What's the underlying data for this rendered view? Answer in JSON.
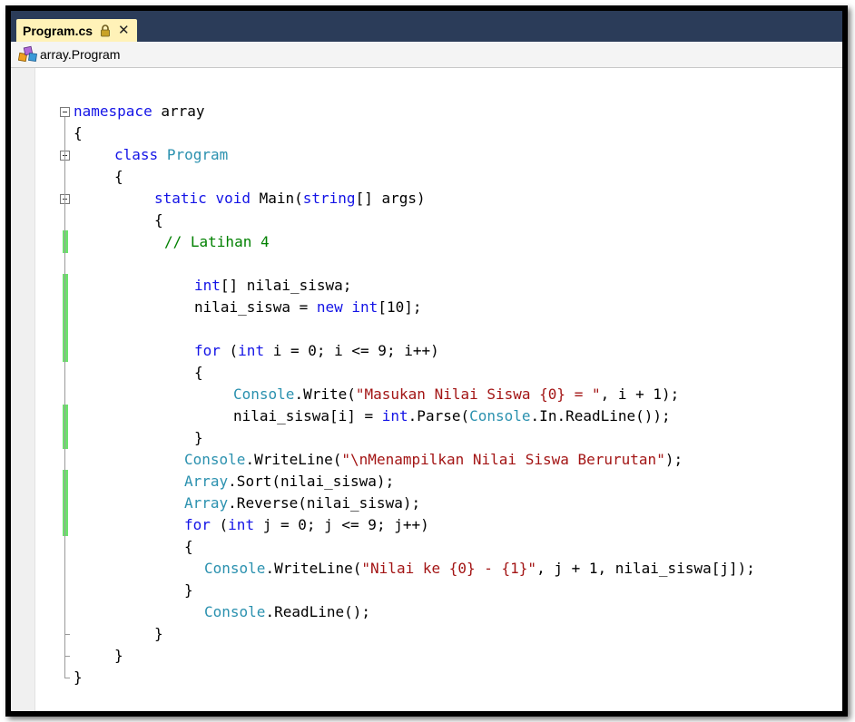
{
  "tab": {
    "label": "Program.cs",
    "close": "✕"
  },
  "navbar": {
    "label": "array.Program"
  },
  "code": {
    "l1": [
      "namespace",
      " array"
    ],
    "l2": [
      "{"
    ],
    "l3": [
      "class",
      " ",
      "Program"
    ],
    "l4": [
      "{"
    ],
    "l5": [
      "static",
      " ",
      "void",
      " Main(",
      "string",
      "[] args)"
    ],
    "l6": [
      "{"
    ],
    "l7": [
      "// Latihan 4"
    ],
    "l9": [
      "int",
      "[] nilai_siswa;"
    ],
    "l10": [
      "nilai_siswa = ",
      "new",
      " ",
      "int",
      "[10];"
    ],
    "l12": [
      "for",
      " (",
      "int",
      " i = 0; i <= 9; i++)"
    ],
    "l13": [
      "{"
    ],
    "l14": [
      "Console",
      ".Write(",
      "\"Masukan Nilai Siswa {0} = \"",
      ", i + 1);"
    ],
    "l15": [
      "nilai_siswa[i] = ",
      "int",
      ".Parse(",
      "Console",
      ".In.ReadLine());"
    ],
    "l16": [
      "}"
    ],
    "l17": [
      "Console",
      ".WriteLine(",
      "\"\\nMenampilkan Nilai Siswa Berurutan\"",
      ");"
    ],
    "l18": [
      "Array",
      ".Sort(nilai_siswa);"
    ],
    "l19": [
      "Array",
      ".Reverse(nilai_siswa);"
    ],
    "l20": [
      "for",
      " (",
      "int",
      " j = 0; j <= 9; j++)"
    ],
    "l21": [
      "{"
    ],
    "l22": [
      "Console",
      ".WriteLine(",
      "\"Nilai ke {0} - {1}\"",
      ", j + 1, nilai_siswa[j]);"
    ],
    "l23": [
      "}"
    ],
    "l24": [
      "Console",
      ".ReadLine();"
    ],
    "l25": [
      "}"
    ],
    "l26": [
      "}"
    ],
    "l27": [
      "}"
    ]
  },
  "colors": {
    "keyword": "#1414e6",
    "type": "#2b91af",
    "string": "#a31515",
    "comment": "#008000",
    "change_marker": "#6ce26c",
    "titlebar": "#2b3c59",
    "active_tab": "#fff2b8"
  },
  "icons": {
    "tab": "lock-icon",
    "navbar": "class-icon",
    "close": "close-icon"
  }
}
